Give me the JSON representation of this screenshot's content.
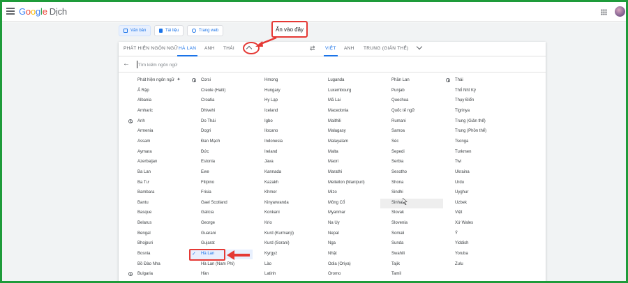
{
  "app": {
    "logo_google": [
      "G",
      "o",
      "o",
      "g",
      "l",
      "e"
    ],
    "logo_product": "Dịch"
  },
  "modes": [
    {
      "label": "Văn bản",
      "icon": "translate-icon",
      "active": true
    },
    {
      "label": "Tài liệu",
      "icon": "document-icon",
      "active": false
    },
    {
      "label": "Trang web",
      "icon": "globe-icon",
      "active": false
    }
  ],
  "source_tabs": [
    "PHÁT HIỆN NGÔN NGỮ",
    "HÀ LAN",
    "ANH",
    "THÁI"
  ],
  "source_active": "HÀ LAN",
  "target_tabs": [
    "VIỆT",
    "ANH",
    "TRUNG (GIẢN THỂ)"
  ],
  "target_active": "VIỆT",
  "search": {
    "placeholder": "Tìm kiếm ngôn ngữ"
  },
  "annotation": {
    "callout": "Ấn vào đây"
  },
  "colors": {
    "accent": "#1a73e8",
    "annotation": "#e53935",
    "frame": "#1e9b3a"
  },
  "selected_language": "Hà Lan",
  "hovered_language": "Sinhala",
  "recent_languages": [
    "Corsi",
    "Anh",
    "Bulgaria",
    "Thái"
  ],
  "columns": [
    [
      "Phát hiện ngôn ngữ",
      "Ả Rập",
      "Albania",
      "Amharic",
      "Anh",
      "Armenia",
      "Assam",
      "Aymara",
      "Azerbaijan",
      "Ba Lan",
      "Ba Tư",
      "Bambara",
      "Bantu",
      "Basque",
      "Belarus",
      "Bengal",
      "Bhojpuri",
      "Bosnia",
      "Bồ Đào Nha",
      "Bulgaria"
    ],
    [
      "Corsi",
      "Creole (Haiti)",
      "Croatia",
      "Dhivehi",
      "Do Thái",
      "Dogri",
      "Đan Mạch",
      "Đức",
      "Estonia",
      "Ewe",
      "Filipino",
      "Frisia",
      "Gael Scotland",
      "Galicia",
      "George",
      "Guarani",
      "Gujarat",
      "Hà Lan",
      "Hà Lan (Nam Phi)",
      "Hàn"
    ],
    [
      "Hmong",
      "Hungary",
      "Hy Lạp",
      "Iceland",
      "Igbo",
      "Ilocano",
      "Indonesia",
      "Ireland",
      "Java",
      "Kannada",
      "Kazakh",
      "Khmer",
      "Kinyarwanda",
      "Konkani",
      "Krio",
      "Kurd (Kurmanji)",
      "Kurd (Sorani)",
      "Kyrgyz",
      "Lào",
      "Latinh"
    ],
    [
      "Luganda",
      "Luxembourg",
      "Mã Lai",
      "Macedonia",
      "Maithili",
      "Malagasy",
      "Malayalam",
      "Malta",
      "Maori",
      "Marathi",
      "Meiteilon (Manipuri)",
      "Mizo",
      "Mông Cổ",
      "Myanmar",
      "Na Uy",
      "Nepal",
      "Nga",
      "Nhật",
      "Odia (Oriya)",
      "Oromo"
    ],
    [
      "Phần Lan",
      "Punjab",
      "Quechua",
      "Quốc tế ngữ",
      "Rumani",
      "Samoa",
      "Séc",
      "Sepedi",
      "Serbia",
      "Sesotho",
      "Shona",
      "Sindhi",
      "Sinhala",
      "Slovak",
      "Slovenia",
      "Somali",
      "Sunda",
      "Swahili",
      "Tajik",
      "Tamil"
    ],
    [
      "Thái",
      "Thổ Nhĩ Kỳ",
      "Thụy Điển",
      "Tigrinya",
      "Trung (Giản thể)",
      "Trung (Phồn thể)",
      "Tsonga",
      "Turkmen",
      "Twi",
      "Ukraina",
      "Urdu",
      "Uyghur",
      "Uzbek",
      "Việt",
      "Xứ Wales",
      "Ý",
      "Yiddish",
      "Yoruba",
      "Zulu"
    ]
  ]
}
